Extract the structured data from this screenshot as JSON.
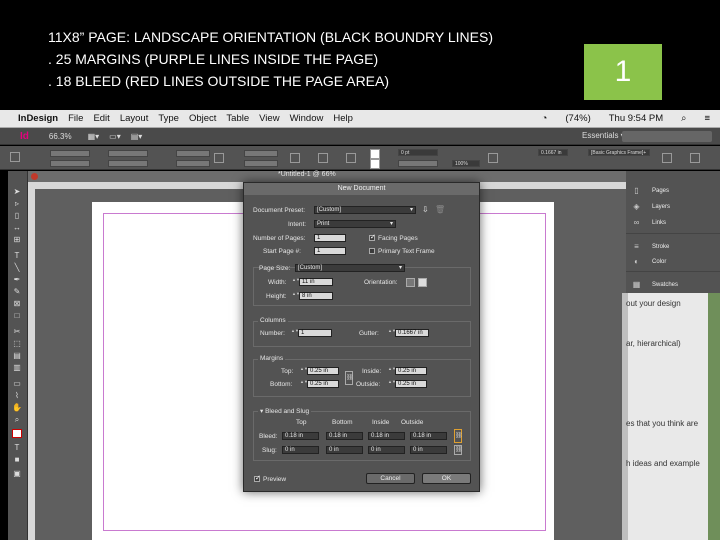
{
  "caption": {
    "line1": "11X8” PAGE: LANDSCAPE ORIENTATION  (BLACK BOUNDRY LINES)",
    "line2": ". 25 MARGINS (PURPLE LINES INSIDE THE PAGE)",
    "line3": ". 18 BLEED (RED LINES OUTSIDE THE PAGE AREA)"
  },
  "slide_number": "1",
  "menubar": {
    "apple": "",
    "app": "InDesign",
    "items": [
      "File",
      "Edit",
      "Layout",
      "Type",
      "Object",
      "Table",
      "View",
      "Window",
      "Help"
    ],
    "battery": "(74%)",
    "clock": "Thu 9:54 PM"
  },
  "appbar": {
    "logo": "Id",
    "zoom": "66.3%",
    "workspace": "Essentials ▾"
  },
  "control": {
    "stroke_weight": "0 pt",
    "opacity": "100%",
    "gutter": "0.1667 in",
    "frame_style": "[Basic Graphics Frame]+"
  },
  "document_tab": {
    "title": "*Untitled-1 @ 66%"
  },
  "right_panel": {
    "items": [
      {
        "icon": "pages-icon",
        "label": "Pages"
      },
      {
        "icon": "layers-icon",
        "label": "Layers"
      },
      {
        "icon": "links-icon",
        "label": "Links"
      },
      {
        "icon": "stroke-icon",
        "label": "Stroke"
      },
      {
        "icon": "color-icon",
        "label": "Color"
      },
      {
        "icon": "swatches-icon",
        "label": "Swatches"
      }
    ]
  },
  "background_window": {
    "lines": [
      "out your design",
      "ar, hierarchical)",
      "es that you think are",
      "h ideas and example"
    ]
  },
  "dialog": {
    "title": "New Document",
    "document_preset_label": "Document Preset:",
    "document_preset_value": "[Custom]",
    "intent_label": "Intent:",
    "intent_value": "Print",
    "number_of_pages_label": "Number of Pages:",
    "number_of_pages_value": "1",
    "facing_pages_label": "Facing Pages",
    "start_page_label": "Start Page #:",
    "start_page_value": "1",
    "primary_text_frame_label": "Primary Text Frame",
    "page_size_label": "Page Size:",
    "page_size_value": "[Custom]",
    "width_label": "Width:",
    "width_value": "11 in",
    "height_label": "Height:",
    "height_value": "8 in",
    "orientation_label": "Orientation:",
    "columns_title": "Columns",
    "columns_number_label": "Number:",
    "columns_number_value": "1",
    "gutter_label": "Gutter:",
    "gutter_value": "0.1667 in",
    "margins_title": "Margins",
    "top_label": "Top:",
    "top_value": "0.25 in",
    "bottom_label": "Bottom:",
    "bottom_value": "0.25 in",
    "inside_label": "Inside:",
    "inside_value": "0.25 in",
    "outside_label": "Outside:",
    "outside_value": "0.25 in",
    "bleed_slug_title": "Bleed and Slug",
    "col_headers": [
      "Top",
      "Bottom",
      "Inside",
      "Outside"
    ],
    "bleed_label": "Bleed:",
    "bleed_values": [
      "0.18 in",
      "0.18 in",
      "0.18 in",
      "0.18 in"
    ],
    "slug_label": "Slug:",
    "slug_values": [
      "0 in",
      "0 in",
      "0 in",
      "0 in"
    ],
    "preview_label": "Preview",
    "cancel_label": "Cancel",
    "ok_label": "OK"
  }
}
